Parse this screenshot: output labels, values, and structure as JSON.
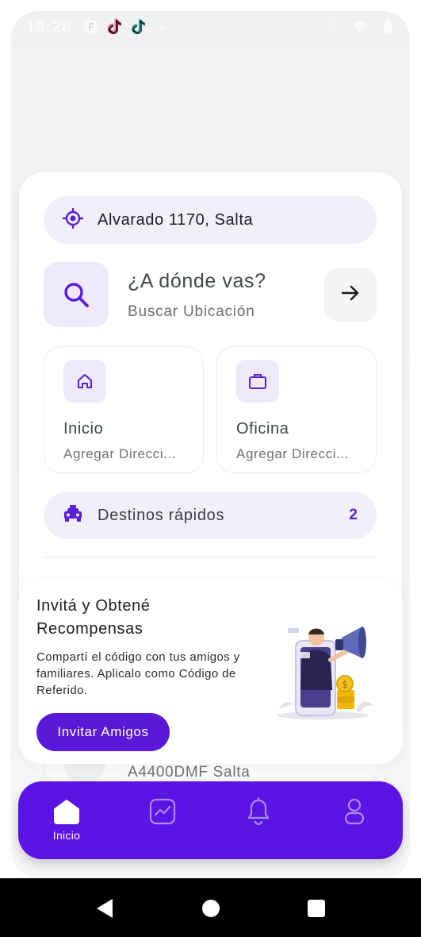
{
  "status_bar": {
    "time": "19:28"
  },
  "location": {
    "address": "Alvarado 1170, Salta"
  },
  "search": {
    "title": "¿A dónde vas?",
    "subtitle": "Buscar Ubicación"
  },
  "shortcuts": [
    {
      "title": "Inicio",
      "subtitle": "Agregar Direcci...",
      "icon": "house-icon"
    },
    {
      "title": "Oficina",
      "subtitle": "Agregar Direcci...",
      "icon": "briefcase-icon"
    }
  ],
  "quick_destinations": {
    "label": "Destinos rápidos",
    "count": "2"
  },
  "background_address": {
    "line2": "A4400DMF Salta"
  },
  "promo": {
    "title": "Invitá y Obtené Recompensas",
    "body": "Compartí el código con tus amigos y familiares. Aplicalo como Código de Referido.",
    "button_label": "Invitar Amigos"
  },
  "bottom_nav": {
    "home_label": "Inicio",
    "active": "home"
  },
  "colors": {
    "accent": "#5c14e4",
    "accent_light": "#f2effc",
    "text_dark": "#3c4646"
  }
}
